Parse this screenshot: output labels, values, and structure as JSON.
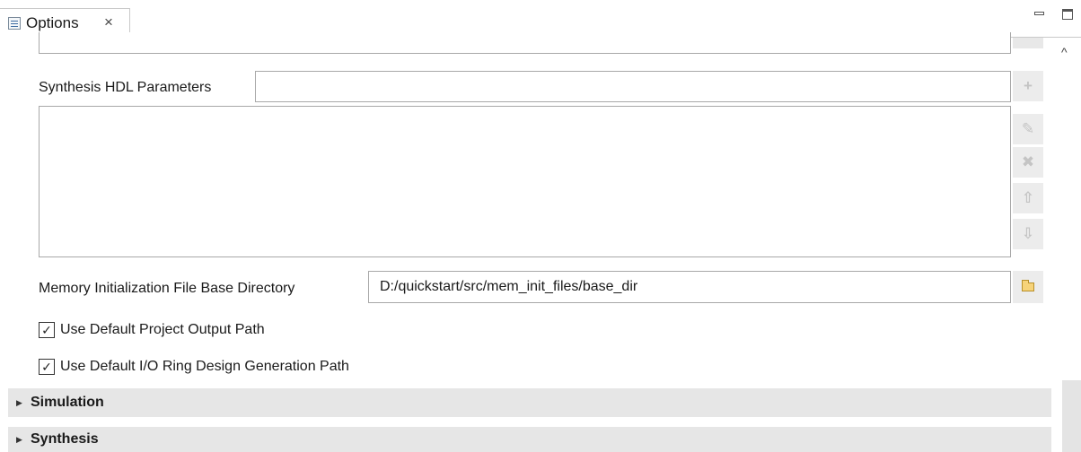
{
  "tab": {
    "title": "Options",
    "close_glyph": "×"
  },
  "window_controls": {
    "minimize": "minimize-icon",
    "maximize": "maximize-icon"
  },
  "hdl": {
    "label": "Synthesis HDL Parameters",
    "input_value": "",
    "list_items": [],
    "buttons": {
      "add": "+",
      "edit": "✎",
      "remove": "✖",
      "move_up": "⇧",
      "move_down": "⇩"
    }
  },
  "memory_init": {
    "label": "Memory Initialization File Base Directory",
    "value": "D:/quickstart/src/mem_init_files/base_dir",
    "browse_icon": "folder-icon"
  },
  "checkboxes": [
    {
      "label": "Use Default Project Output Path",
      "checked": true
    },
    {
      "label": "Use Default I/O Ring Design Generation Path",
      "checked": true
    }
  ],
  "sections": [
    {
      "title": "Simulation",
      "expanded": false
    },
    {
      "title": "Synthesis",
      "expanded": false
    }
  ],
  "glyphs": {
    "check": "✓",
    "collapsed_arrow": "▶",
    "scroll_up": "^"
  }
}
